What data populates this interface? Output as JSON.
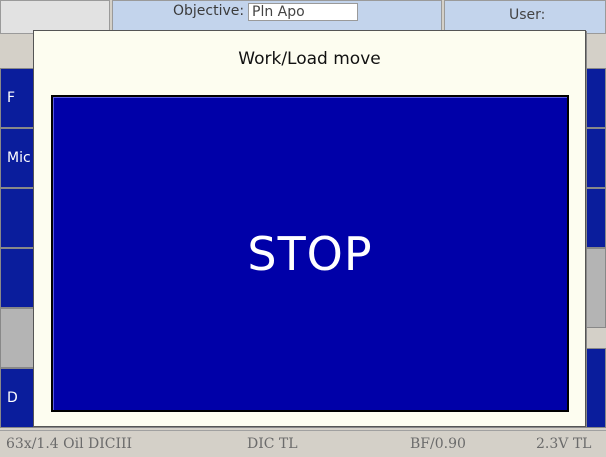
{
  "background": {
    "objective": {
      "label": "Objective:",
      "value": "Pln Apo"
    },
    "user": {
      "label": "User:"
    },
    "side_buttons_left": [
      "F",
      "Mic",
      "",
      "",
      "",
      "D"
    ],
    "status_bar": {
      "objective": "63x/1.4 Oil DICIII",
      "method": "DIC TL",
      "filter": "BF/0.90",
      "voltage": "2.3V TL"
    }
  },
  "dialog": {
    "title": "Work/Load move",
    "stop_button_label": "STOP"
  },
  "colors": {
    "dialog_bg": "#fdfdf0",
    "stop_button_bg": "#0000a8",
    "side_button_blue": "#0a1d9c"
  }
}
